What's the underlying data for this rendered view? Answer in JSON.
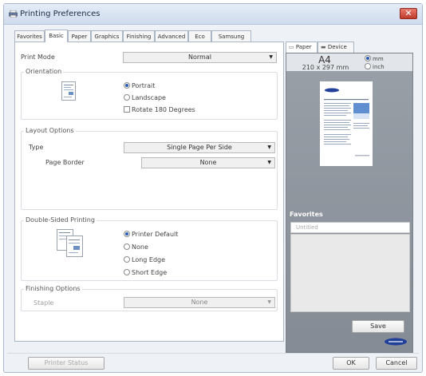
{
  "window": {
    "title": "Printing Preferences",
    "close_glyph": "✕"
  },
  "tabs": [
    {
      "label": "Favorites"
    },
    {
      "label": "Basic"
    },
    {
      "label": "Paper"
    },
    {
      "label": "Graphics"
    },
    {
      "label": "Finishing"
    },
    {
      "label": "Advanced"
    },
    {
      "label": "Eco"
    },
    {
      "label": "Samsung"
    }
  ],
  "active_tab": "Basic",
  "print_mode": {
    "label": "Print Mode",
    "value": "Normal"
  },
  "orientation": {
    "title": "Orientation",
    "options": [
      "Portrait",
      "Landscape"
    ],
    "selected": "Portrait",
    "rotate_label": "Rotate 180 Degrees",
    "rotate_checked": false
  },
  "layout": {
    "title": "Layout Options",
    "type_label": "Type",
    "type_value": "Single Page Per Side",
    "border_label": "Page Border",
    "border_value": "None"
  },
  "duplex": {
    "title": "Double-Sided Printing",
    "options": [
      "Printer Default",
      "None",
      "Long Edge",
      "Short Edge"
    ],
    "selected": "Printer Default"
  },
  "finishing": {
    "title": "Finishing Options",
    "staple_label": "Staple",
    "staple_value": "None"
  },
  "preview": {
    "tabs": [
      "Paper",
      "Device"
    ],
    "paper_size": "A4",
    "paper_dims": "210 x 297 mm",
    "units": [
      "mm",
      "inch"
    ],
    "selected_unit": "mm"
  },
  "favorites": {
    "title": "Favorites",
    "placeholder": "Untitled",
    "save_label": "Save"
  },
  "footer": {
    "printer_status": "Printer Status",
    "ok": "OK",
    "cancel": "Cancel"
  },
  "colors": {
    "preview_bg": "#8f959d",
    "accent": "#2a5bb8",
    "samsung_blue": "#1f3f9a"
  }
}
